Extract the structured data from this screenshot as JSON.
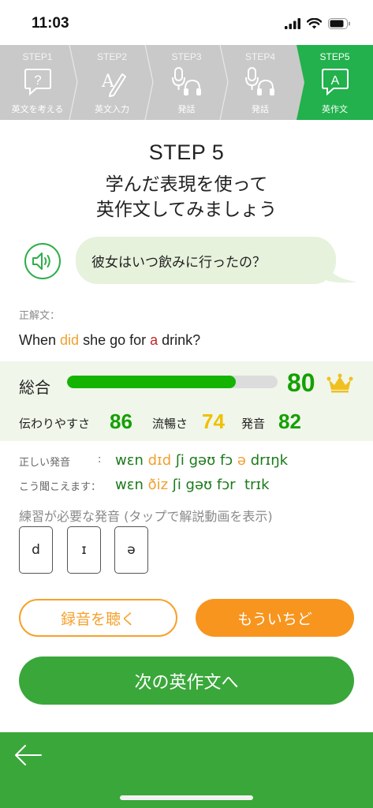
{
  "status": {
    "time": "11:03"
  },
  "steps": [
    {
      "num": "STEP1",
      "label": "英文を考える",
      "icon": "question-bubble-icon"
    },
    {
      "num": "STEP2",
      "label": "英文入力",
      "icon": "pencil-a-icon"
    },
    {
      "num": "STEP3",
      "label": "発話",
      "icon": "mic-headphones-icon"
    },
    {
      "num": "STEP4",
      "label": "発話",
      "icon": "mic-headphones-icon"
    },
    {
      "num": "STEP5",
      "label": "英作文",
      "icon": "a-bubble-icon",
      "active": true
    }
  ],
  "header": {
    "step": "STEP 5",
    "line1": "学んだ表現を使って",
    "line2": "英作文してみましょう"
  },
  "prompt": {
    "text": "彼女はいつ飲みに行ったの？",
    "speaker_icon": "speaker-icon"
  },
  "answer": {
    "label": "正解文：",
    "parts": [
      "When ",
      "did",
      " she go for ",
      "a",
      " drink?"
    ]
  },
  "scores": {
    "total_label": "総合",
    "total": "80",
    "total_progress": 0.8,
    "clarity_label": "伝わりやすさ",
    "clarity": "86",
    "fluency_label": "流暢さ",
    "fluency": "74",
    "pronunciation_label": "発音",
    "pronunciation": "82"
  },
  "pronunciation": {
    "correct_label": "正しい発音",
    "colon": ":",
    "heard_label": "こう聞こえます：",
    "correct_parts": [
      "wɛn ",
      "dɪd",
      " ʃi gəʊ fɔ ",
      "ə",
      " drɪŋk"
    ],
    "heard_parts": [
      "wɛn ",
      "ðiz",
      " ʃi gəʊ fɔr  trɪk"
    ]
  },
  "practice": {
    "label": "練習が必要な発音 (タップで解説動画を表示)",
    "phonemes": [
      "d",
      "ɪ",
      "ə"
    ]
  },
  "buttons": {
    "listen": "録音を聴く",
    "retry": "もういちど",
    "next": "次の英作文へ"
  },
  "colors": {
    "green": "#22b14c",
    "orange": "#f7951e",
    "score_green": "#14a000",
    "score_yellow": "#f0c000"
  }
}
